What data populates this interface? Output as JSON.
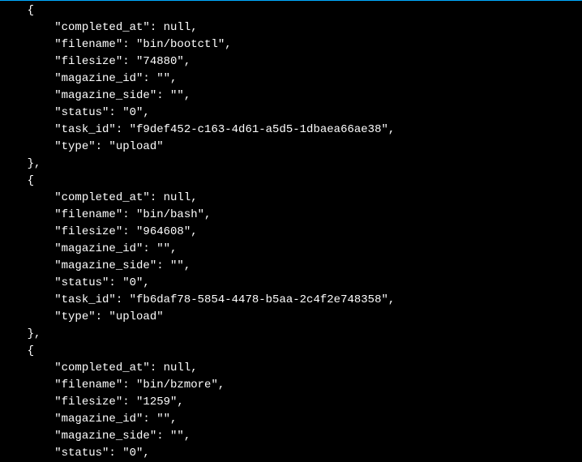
{
  "records": [
    {
      "completed_at": null,
      "filename": "bin/bootctl",
      "filesize": "74880",
      "magazine_id": "",
      "magazine_side": "",
      "status": "0",
      "task_id": "f9def452-c163-4d61-a5d5-1dbaea66ae38",
      "type": "upload"
    },
    {
      "completed_at": null,
      "filename": "bin/bash",
      "filesize": "964608",
      "magazine_id": "",
      "magazine_side": "",
      "status": "0",
      "task_id": "fb6daf78-5854-4478-b5aa-2c4f2e748358",
      "type": "upload"
    },
    {
      "completed_at": null,
      "filename": "bin/bzmore",
      "filesize": "1259",
      "magazine_id": "",
      "magazine_side": "",
      "status": "0"
    }
  ],
  "last_record_partial": true,
  "key_order": [
    "completed_at",
    "filename",
    "filesize",
    "magazine_id",
    "magazine_side",
    "status",
    "task_id",
    "type"
  ]
}
